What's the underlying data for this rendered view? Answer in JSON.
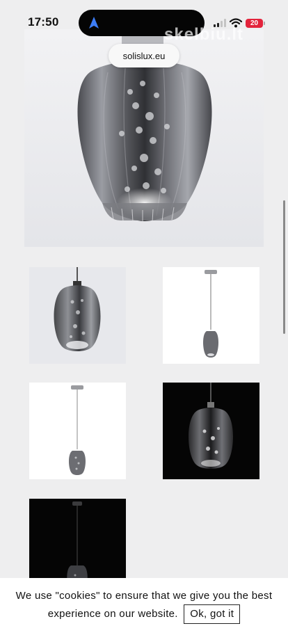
{
  "status_bar": {
    "time": "17:50",
    "battery_level": "20",
    "watermark": "skelbiu.lt",
    "icons": [
      "navigation-arrow-icon",
      "cellular-signal-icon",
      "wifi-icon",
      "battery-icon"
    ]
  },
  "browser": {
    "url": "solislux.eu"
  },
  "gallery": {
    "main_image": "pendant-lamp-smoked-glass-crystals",
    "thumbnails": [
      {
        "name": "thumbnail-lamp-closeup",
        "background": "light"
      },
      {
        "name": "thumbnail-lamp-white-bg",
        "background": "white"
      },
      {
        "name": "thumbnail-lamp-white-bg-2",
        "background": "white"
      },
      {
        "name": "thumbnail-lamp-dark-bg",
        "background": "black"
      },
      {
        "name": "thumbnail-lamp-dark-bg-2",
        "background": "black"
      }
    ]
  },
  "cookie_banner": {
    "line1": "We use \"cookies\" to ensure that we give you the best",
    "line2": "experience on our website.",
    "button_label": "Ok, got it"
  },
  "colors": {
    "page_bg": "#eeeeef",
    "battery": "#e3233b",
    "nav_arrow": "#3d7df5",
    "banner_bg": "#ffffff"
  }
}
